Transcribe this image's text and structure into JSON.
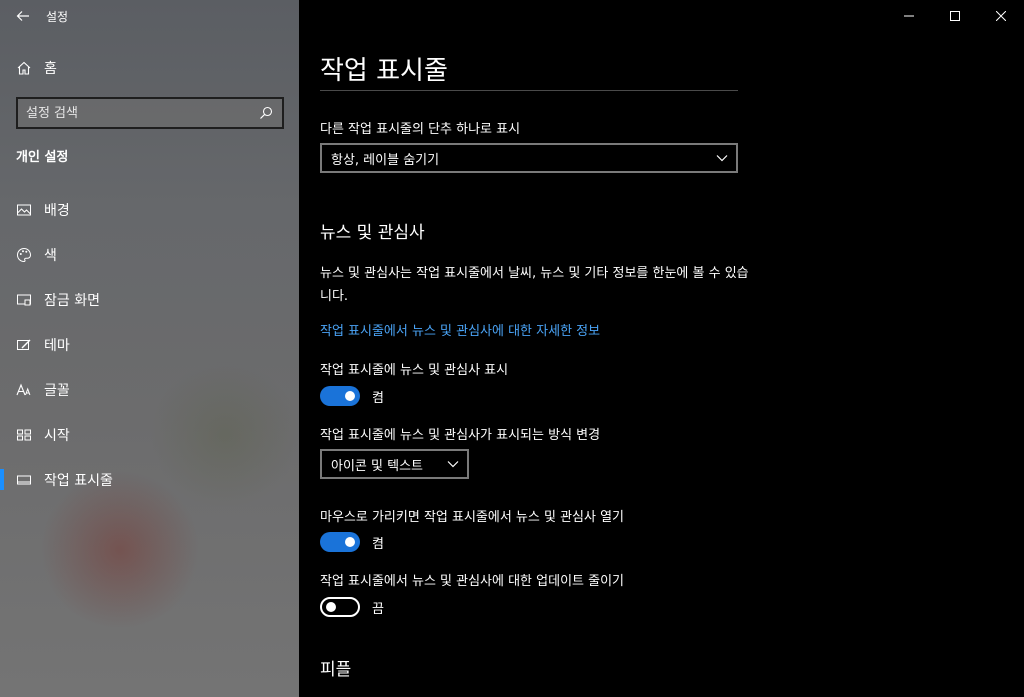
{
  "window": {
    "app_title": "설정"
  },
  "sidebar": {
    "home_label": "홈",
    "search_placeholder": "설정 검색",
    "section_heading": "개인 설정",
    "items": [
      {
        "label": "배경",
        "icon": "image-icon"
      },
      {
        "label": "색",
        "icon": "palette-icon"
      },
      {
        "label": "잠금 화면",
        "icon": "lock-screen-icon"
      },
      {
        "label": "테마",
        "icon": "theme-brush-icon"
      },
      {
        "label": "글꼴",
        "icon": "font-icon"
      },
      {
        "label": "시작",
        "icon": "start-grid-icon"
      },
      {
        "label": "작업 표시줄",
        "icon": "taskbar-icon",
        "active": true
      }
    ]
  },
  "main": {
    "page_title": "작업 표시줄",
    "combine_label": "다른 작업 표시줄의 단추 하나로 표시",
    "combine_value": "항상, 레이블 숨기기",
    "news_title": "뉴스 및 관심사",
    "news_desc": "뉴스 및 관심사는 작업 표시줄에서 날씨, 뉴스 및 기타 정보를 한눈에 볼 수 있습니다.",
    "news_link": "작업 표시줄에서 뉴스 및 관심사에 대한 자세한 정보",
    "show_news_label": "작업 표시줄에 뉴스 및 관심사 표시",
    "show_news_state": "켬",
    "display_mode_label": "작업 표시줄에 뉴스 및 관심사가 표시되는 방식 변경",
    "display_mode_value": "아이콘 및 텍스트",
    "hover_open_label": "마우스로 가리키면 작업 표시줄에서 뉴스 및 관심사 열기",
    "hover_open_state": "켬",
    "reduce_updates_label": "작업 표시줄에서 뉴스 및 관심사에 대한 업데이트 줄이기",
    "reduce_updates_state": "끔",
    "people_title": "피플"
  },
  "colors": {
    "accent": "#1a73d9",
    "link": "#4aa3f5",
    "active_indicator": "#1a8fff"
  }
}
